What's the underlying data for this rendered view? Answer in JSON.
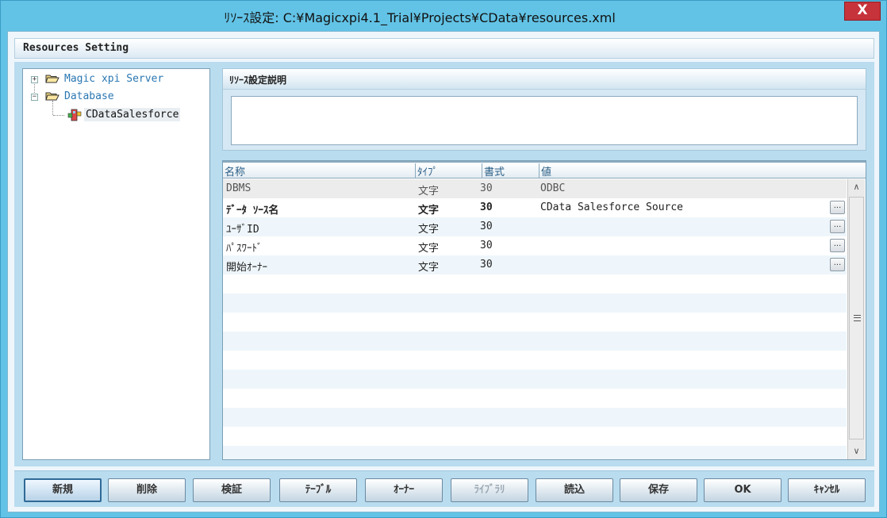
{
  "window": {
    "title": "ﾘｿｰｽ設定: C:¥Magicxpi4.1_Trial¥Projects¥CData¥resources.xml",
    "close_label": "X"
  },
  "section": {
    "title": "Resources Setting"
  },
  "tree": {
    "items": [
      {
        "label": "Magic xpi Server",
        "expander": "+",
        "icon": "folder-open-icon"
      },
      {
        "label": "Database",
        "expander": "−",
        "icon": "folder-open-icon"
      },
      {
        "label": "CDataSalesforce",
        "icon": "database-resource-icon"
      }
    ]
  },
  "description": {
    "header": "ﾘｿｰｽ設定説明",
    "text": ""
  },
  "grid": {
    "columns": [
      "名称",
      "ﾀｲﾌﾟ",
      "書式",
      "値"
    ],
    "rows": [
      {
        "name": "DBMS",
        "type": "文字",
        "format": "30",
        "value": "ODBC",
        "has_button": false,
        "style": "readonly"
      },
      {
        "name": "ﾃﾞｰﾀ ｿｰｽ名",
        "type": "文字",
        "format": "30",
        "value": "CData Salesforce Source",
        "has_button": true,
        "style": "bold"
      },
      {
        "name": "ﾕｰｻﾞID",
        "type": "文字",
        "format": "30",
        "value": "",
        "has_button": true,
        "style": "normal"
      },
      {
        "name": "ﾊﾟｽﾜｰﾄﾞ",
        "type": "文字",
        "format": "30",
        "value": "",
        "has_button": true,
        "style": "normal"
      },
      {
        "name": "開始ｵｰﾅｰ",
        "type": "文字",
        "format": "30",
        "value": "",
        "has_button": true,
        "style": "normal"
      }
    ],
    "ellipsis_label": "..."
  },
  "buttons": [
    {
      "label": "新規",
      "state": "default"
    },
    {
      "label": "削除",
      "state": "normal"
    },
    {
      "label": "検証",
      "state": "normal"
    },
    {
      "label": "ﾃｰﾌﾞﾙ",
      "state": "normal"
    },
    {
      "label": "ｵｰﾅｰ",
      "state": "normal"
    },
    {
      "label": "ﾗｲﾌﾞﾗﾘ",
      "state": "disabled"
    },
    {
      "label": "読込",
      "state": "normal"
    },
    {
      "label": "保存",
      "state": "normal"
    },
    {
      "label": "OK",
      "state": "normal"
    },
    {
      "label": "ｷｬﾝｾﾙ",
      "state": "normal"
    }
  ],
  "colors": {
    "titlebar": "#62c3e6",
    "close": "#c7333b",
    "link": "#2a77b2"
  }
}
